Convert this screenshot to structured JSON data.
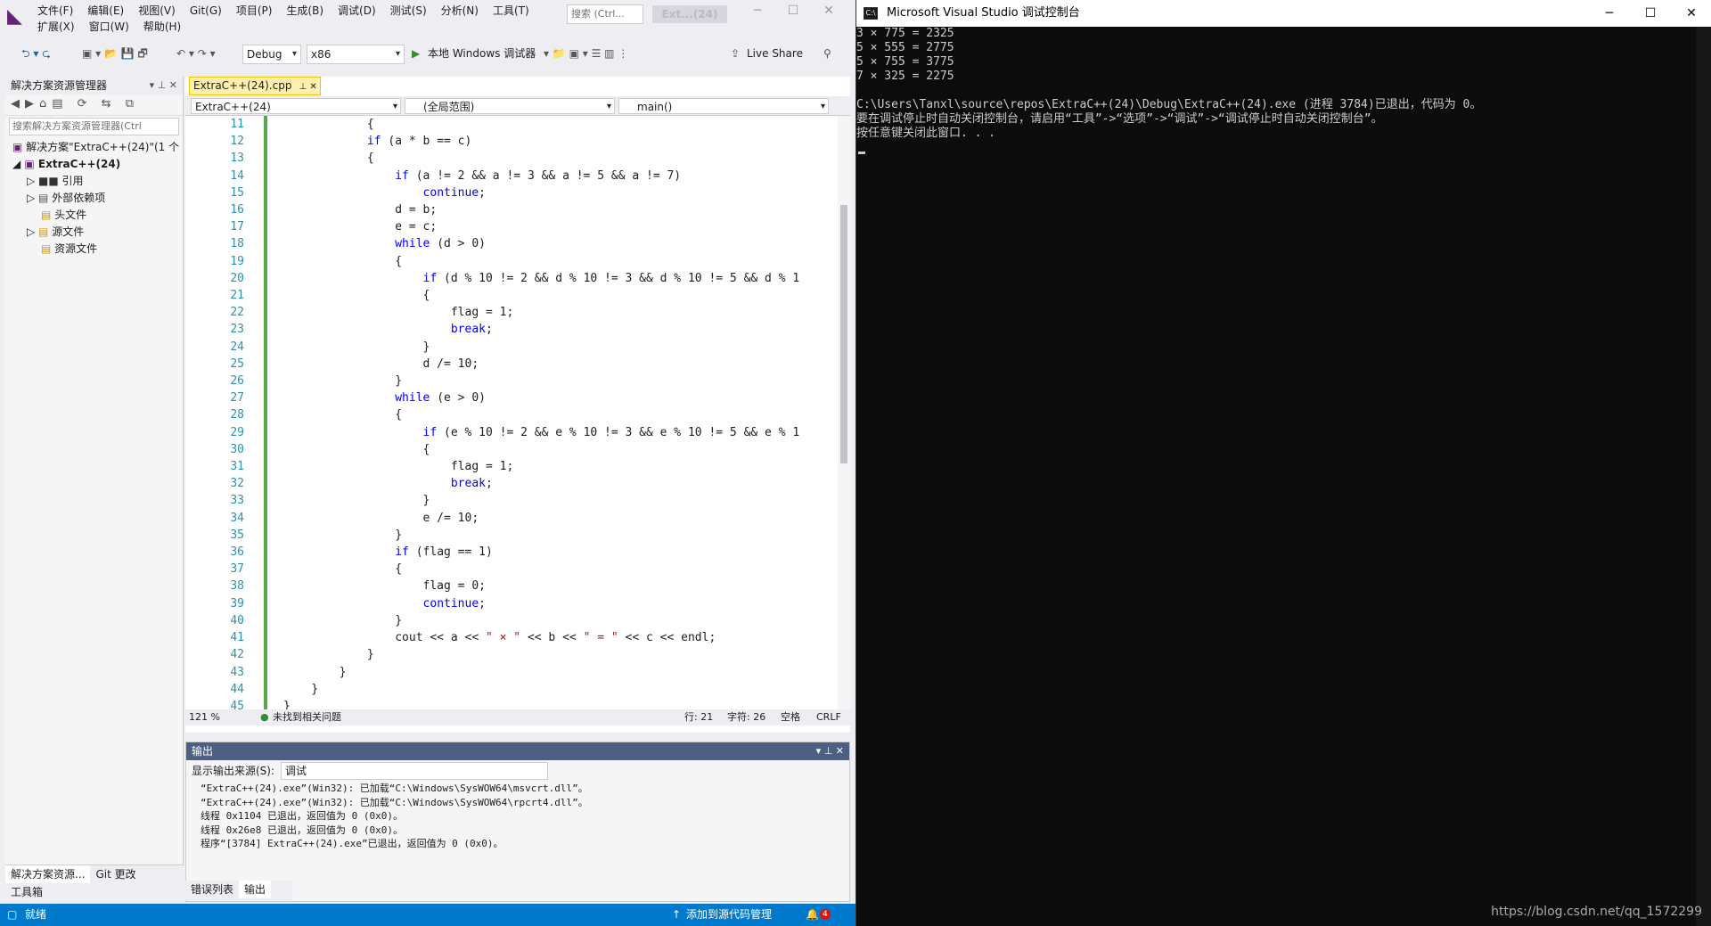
{
  "menus": [
    "文件(F)",
    "编辑(E)",
    "视图(V)",
    "Git(G)",
    "项目(P)",
    "生成(B)",
    "调试(D)",
    "测试(S)",
    "分析(N)",
    "工具(T)"
  ],
  "menus2": [
    "扩展(X)",
    "窗口(W)",
    "帮助(H)"
  ],
  "search_placeholder": "搜索 (Ctrl...",
  "window_title": "Ext...(24)",
  "toolbar": {
    "config": "Debug",
    "platform": "x86",
    "run": "本地 Windows 调试器",
    "liveshare": "Live Share"
  },
  "solution": {
    "title": "解决方案资源管理器",
    "search": "搜索解决方案资源管理器(Ctrl",
    "items": [
      "解决方案\"ExtraC++(24)\"(1 个",
      "ExtraC++(24)",
      "引用",
      "外部依赖项",
      "头文件",
      "源文件",
      "资源文件"
    ],
    "tabs": [
      "解决方案资源...",
      "Git 更改",
      "工具箱"
    ]
  },
  "editor": {
    "tab": "ExtraC++(24).cpp",
    "nav_project": "ExtraC++(24)",
    "nav_scope": "(全局范围)",
    "nav_func": "main()",
    "line_numbers": [
      "11",
      "12",
      "13",
      "14",
      "15",
      "16",
      "17",
      "18",
      "19",
      "20",
      "21",
      "22",
      "23",
      "24",
      "25",
      "26",
      "27",
      "28",
      "29",
      "30",
      "31",
      "32",
      "33",
      "34",
      "35",
      "36",
      "37",
      "38",
      "39",
      "40",
      "41",
      "42",
      "43",
      "44",
      "45"
    ],
    "lines": [
      "            {",
      "            if (a * b == c)",
      "            {",
      "                if (a != 2 && a != 3 && a != 5 && a != 7)",
      "                    continue;",
      "                d = b;",
      "                e = c;",
      "                while (d > 0)",
      "                {",
      "                    if (d % 10 != 2 && d % 10 != 3 && d % 10 != 5 && d % 1",
      "                    {",
      "                        flag = 1;",
      "                        break;",
      "                    }",
      "                    d /= 10;",
      "                }",
      "                while (e > 0)",
      "                {",
      "                    if (e % 10 != 2 && e % 10 != 3 && e % 10 != 5 && e % 1",
      "                    {",
      "                        flag = 1;",
      "                        break;",
      "                    }",
      "                    e /= 10;",
      "                }",
      "                if (flag == 1)",
      "                {",
      "                    flag = 0;",
      "                    continue;",
      "                }",
      "                cout << a << \" × \" << b << \" = \" << c << endl;",
      "            }",
      "        }",
      "    }",
      "}"
    ],
    "zoom": "121 %",
    "issues": "未找到相关问题",
    "row": "行: 21",
    "col": "字符: 26",
    "ws": "空格",
    "eol": "CRLF"
  },
  "output": {
    "title": "输出",
    "source_label": "显示输出来源(S):",
    "source": "调试",
    "lines": [
      "“ExtraC++(24).exe”(Win32): 已加载“C:\\Windows\\SysWOW64\\msvcrt.dll”。",
      "“ExtraC++(24).exe”(Win32): 已加载“C:\\Windows\\SysWOW64\\rpcrt4.dll”。",
      "线程 0x1104 已退出，返回值为 0 (0x0)。",
      "线程 0x26e8 已退出，返回值为 0 (0x0)。",
      "程序“[3784] ExtraC++(24).exe”已退出，返回值为 0 (0x0)。"
    ],
    "tabs": [
      "错误列表",
      "输出"
    ]
  },
  "status": {
    "ready": "就绪",
    "scm": "添加到源代码管理",
    "notif": "4"
  },
  "console": {
    "title": "Microsoft Visual Studio 调试控制台",
    "lines": [
      "3 × 775 = 2325",
      "5 × 555 = 2775",
      "5 × 755 = 3775",
      "7 × 325 = 2275",
      "",
      "C:\\Users\\Tanxl\\source\\repos\\ExtraC++(24)\\Debug\\ExtraC++(24).exe (进程 3784)已退出，代码为 0。",
      "要在调试停止时自动关闭控制台，请启用“工具”->“选项”->“调试”->“调试停止时自动关闭控制台”。",
      "按任意键关闭此窗口. . ."
    ],
    "watermark": "https://blog.csdn.net/qq_1572299"
  }
}
